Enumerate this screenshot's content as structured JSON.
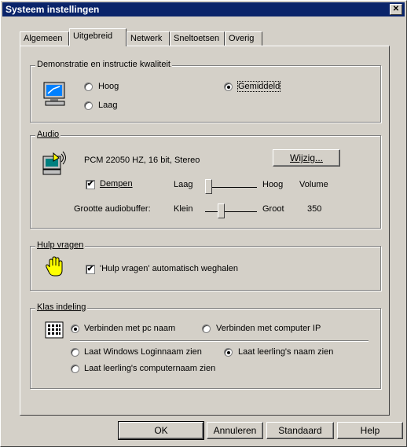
{
  "window": {
    "title": "Systeem instellingen",
    "close": "✕"
  },
  "tabs": [
    {
      "label": "Algemeen",
      "active": false
    },
    {
      "label": "Uitgebreid",
      "active": true
    },
    {
      "label": "Netwerk",
      "active": false
    },
    {
      "label": "Sneltoetsen",
      "active": false
    },
    {
      "label": "Overig",
      "active": false
    }
  ],
  "demo": {
    "legend": "Demonstratie en instructie kwaliteit",
    "options": {
      "hoog": "Hoog",
      "laag": "Laag",
      "gemiddeld": "Gemiddeld"
    },
    "selected": "Gemiddeld"
  },
  "audio": {
    "legend": "Audio",
    "format": "PCM 22050 HZ, 16 bit, Stereo",
    "change_button": "Wijzig...",
    "mute_label": "Dempen",
    "mute_checked": true,
    "volume": {
      "low": "Laag",
      "high": "Hoog",
      "label": "Volume",
      "level": 0
    },
    "buffer": {
      "label": "Grootte audiobuffer:",
      "low": "Klein",
      "high": "Groot",
      "value": "350",
      "level": 0.25
    }
  },
  "help": {
    "legend": "Hulp vragen",
    "auto_remove_label": "'Hulp vragen' automatisch weghalen",
    "auto_remove_checked": true
  },
  "klas": {
    "legend": "Klas indeling",
    "connect_pc": "Verbinden met pc naam",
    "connect_ip": "Verbinden met computer IP",
    "show_windows": "Laat Windows Loginnaam zien",
    "show_student": "Laat leerling's naam zien",
    "show_computer": "Laat leerling's computernaam zien",
    "connect_selected": "Verbinden met pc naam",
    "display_selected": "Laat leerling's naam zien"
  },
  "buttons": {
    "ok": "OK",
    "cancel": "Annuleren",
    "default": "Standaard",
    "help": "Help"
  },
  "colors": {
    "titlebar": "#0a246a",
    "face": "#d4d0c8"
  }
}
